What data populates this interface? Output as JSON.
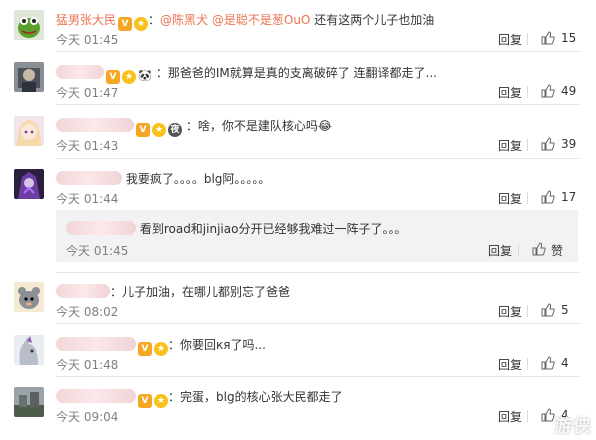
{
  "comments": [
    {
      "username": "猛男张大民",
      "mentions": [
        "@陈黑犬",
        "@是聪不是葱OuO"
      ],
      "text": "还有这两个儿子也加油",
      "time": "今天 01:45",
      "reply_label": "回复",
      "likes": "15"
    },
    {
      "text": "：那爸爸的IM就算是真的支离破碎了 连翻译都走了...",
      "time": "今天 01:47",
      "reply_label": "回复",
      "likes": "49"
    },
    {
      "badge_text": "夜",
      "text": "：啥，你不是建队核心吗",
      "emoji": "😂",
      "time": "今天 01:43",
      "reply_label": "回复",
      "likes": "39"
    },
    {
      "text": "我要疯了。。。。blg阿。。。。。",
      "time": "今天 01:44",
      "reply_label": "回复",
      "likes": "17"
    },
    {
      "text": "：儿子加油，在哪儿都别忘了爸爸",
      "time": "今天 08:02",
      "reply_label": "回复",
      "likes": "5"
    },
    {
      "text": "：你要回кя了吗...",
      "time": "今天 01:48",
      "reply_label": "回复",
      "likes": "4"
    },
    {
      "text": "：完蛋，blg的核心张大民都走了",
      "time": "今天 09:04",
      "reply_label": "回复",
      "likes": "4"
    }
  ],
  "sub_comment": {
    "text": "看到road和jinjiao分开已经够我难过一阵子了。。。",
    "time": "今天 01:45",
    "reply_label": "回复",
    "like_label": "赞"
  },
  "watermark": "游侠"
}
